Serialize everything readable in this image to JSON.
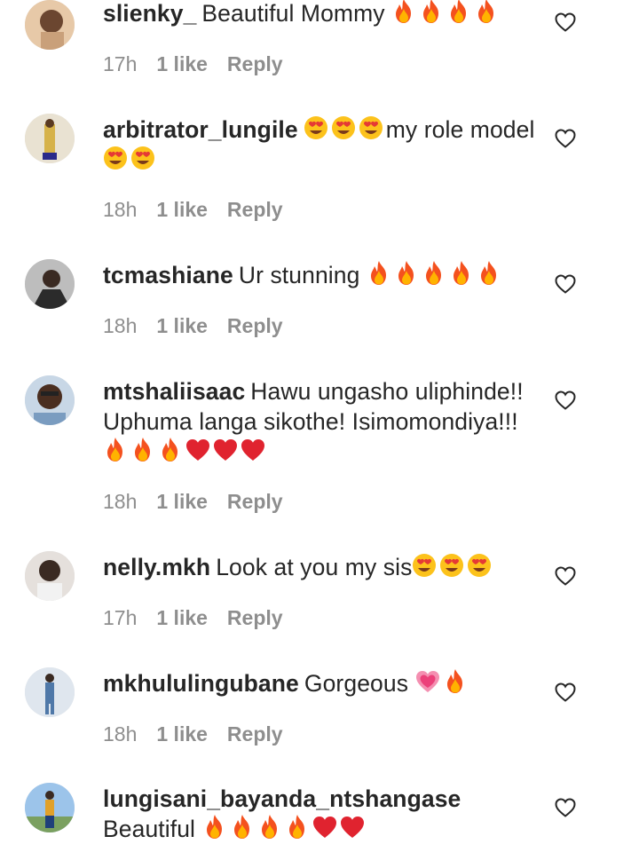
{
  "comments": [
    {
      "username": "slienky_",
      "text": "Beautiful Mommy",
      "emojis_after": [
        "fire",
        "fire",
        "fire",
        "fire"
      ],
      "time": "17h",
      "likes": "1 like",
      "reply": "Reply",
      "avatar_color": "#c9a07a"
    },
    {
      "username": "arbitrator_lungile",
      "text_prefix_emojis": [
        "heart-eyes",
        "heart-eyes",
        "heart-eyes"
      ],
      "text": "my role model",
      "emojis_after": [
        "heart-eyes",
        "heart-eyes"
      ],
      "time": "18h",
      "likes": "1 like",
      "reply": "Reply",
      "avatar_color": "#d6b24a"
    },
    {
      "username": "tcmashiane",
      "text": "Ur stunning",
      "emojis_after": [
        "fire",
        "fire",
        "fire",
        "fire",
        "fire"
      ],
      "time": "18h",
      "likes": "1 like",
      "reply": "Reply",
      "avatar_color": "#6b6b6b"
    },
    {
      "username": "mtshaliisaac",
      "text": "Hawu ungasho uliphinde!! Uphuma langa sikothe! Isimomondiya!!!",
      "emojis_after": [
        "fire",
        "fire",
        "fire",
        "red-heart",
        "red-heart",
        "red-heart"
      ],
      "time": "18h",
      "likes": "1 like",
      "reply": "Reply",
      "avatar_color": "#5a3a2a"
    },
    {
      "username": "nelly.mkh",
      "text": "Look at you my sis",
      "emojis_after": [
        "heart-eyes",
        "heart-eyes",
        "heart-eyes"
      ],
      "time": "17h",
      "likes": "1 like",
      "reply": "Reply",
      "avatar_color": "#9a8a80"
    },
    {
      "username": "mkhululingubane",
      "text": "Gorgeous",
      "emojis_after": [
        "pink-heart",
        "fire"
      ],
      "time": "18h",
      "likes": "1 like",
      "reply": "Reply",
      "avatar_color": "#7f97b0"
    },
    {
      "username": "lungisani_bayanda_ntshangase",
      "text": "Beautiful",
      "emojis_after": [
        "fire",
        "fire",
        "fire",
        "fire",
        "red-heart",
        "red-heart"
      ],
      "time": "",
      "likes": "",
      "reply": "",
      "avatar_color": "#8fb3d9"
    }
  ],
  "icons": {
    "like": "heart-outline-icon"
  },
  "colors": {
    "text": "#262626",
    "meta": "#8e8e8e",
    "background": "#ffffff"
  }
}
